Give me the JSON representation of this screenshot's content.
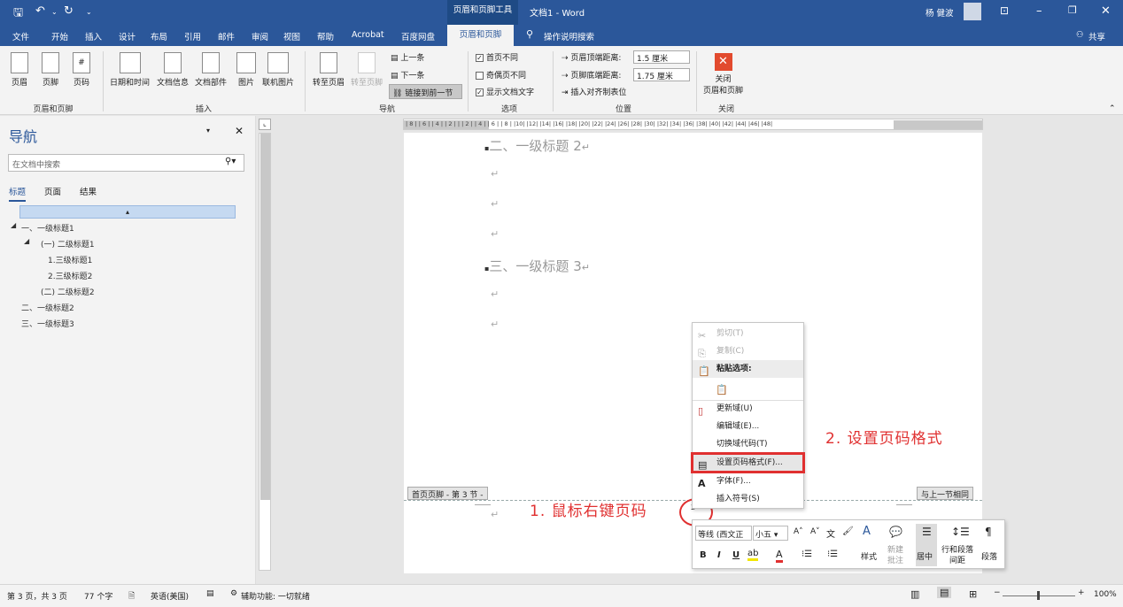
{
  "title": {
    "tool_context": "页眉和页脚工具",
    "doc": "文档1",
    "dash": "-",
    "app": "Word",
    "user": "杨 健波"
  },
  "tabs": [
    "文件",
    "开始",
    "插入",
    "设计",
    "布局",
    "引用",
    "邮件",
    "审阅",
    "视图",
    "帮助",
    "Acrobat",
    "百度网盘",
    "页眉和页脚"
  ],
  "tell_me": "操作说明搜索",
  "share": "共享",
  "ribbon": {
    "hf": {
      "header": "页眉",
      "footer": "页脚",
      "page_number": "页码",
      "group": "页眉和页脚"
    },
    "insert": {
      "datetime": "日期和时间",
      "docinfo": "文档信息",
      "parts": "文档部件",
      "picture": "图片",
      "online_pic": "联机图片",
      "group": "插入"
    },
    "navigation": {
      "goto_header": "转至页眉",
      "goto_footer": "转至页脚",
      "prev": "上一条",
      "next": "下一条",
      "link_prev": "链接到前一节",
      "group": "导航"
    },
    "options": {
      "diff_first": "首页不同",
      "diff_oddeven": "奇偶页不同",
      "show_text": "显示文档文字",
      "group": "选项"
    },
    "position": {
      "header_top": "页眉顶端距离:",
      "header_top_val": "1.5 厘米",
      "footer_bottom": "页脚底端距离:",
      "footer_bottom_val": "1.75 厘米",
      "insert_align_tab": "插入对齐制表位",
      "group": "位置"
    },
    "close": {
      "label1": "关闭",
      "label2": "页眉和页脚",
      "group": "关闭"
    }
  },
  "nav": {
    "title": "导航",
    "search_placeholder": "在文档中搜索",
    "tabs": [
      "标题",
      "页面",
      "结果"
    ],
    "tree": [
      "一、一级标题1",
      "(一) 二级标题1",
      "1.三级标题1",
      "2.三级标题2",
      "(二) 二级标题2",
      "二、一级标题2",
      "三、一级标题3"
    ]
  },
  "ruler_h": "| 8 |  | 6 |  | 4 |  | 2 |  |  | 2 |  | 4 |  | 6 |  | 8 |  |10|  |12|  |14|  |16|  |18|  |20|  |22|  |24|  |26|  |28|  |30|  |32|  |34|  |36|  |38|  |40|  |42|  |44|  |46|  |48|",
  "doc": {
    "heading2": "二、一级标题 2",
    "heading3": "三、一级标题 3",
    "para_mark": "↵",
    "footer_tag": "首页页脚 - 第 3 节 -",
    "same_as_prev": "与上一节相同",
    "footer_num": "2"
  },
  "ctx": {
    "cut": "剪切(T)",
    "copy": "复制(C)",
    "paste_opts": "粘贴选项:",
    "update": "更新域(U)",
    "edit": "编辑域(E)...",
    "toggle": "切换域代码(T)",
    "format_num": "设置页码格式(F)...",
    "font": "字体(F)...",
    "insert_symbol": "插入符号(S)"
  },
  "mini": {
    "font": "等线 (西文正",
    "size": "小五",
    "styles": "样式",
    "new_comment1": "新建",
    "new_comment2": "批注",
    "center": "居中",
    "spacing1": "行和段落",
    "spacing2": "间距",
    "para": "段落"
  },
  "annotations": {
    "step1": "1. 鼠标右键页码",
    "step2": "2. 设置页码格式"
  },
  "status": {
    "page": "第 3 页，共 3 页",
    "words": "77 个字",
    "lang": "英语(美国)",
    "access": "辅助功能: 一切就绪",
    "zoom": "100%"
  },
  "colors": {
    "brand": "#2b579a",
    "annot": "#e03030"
  }
}
